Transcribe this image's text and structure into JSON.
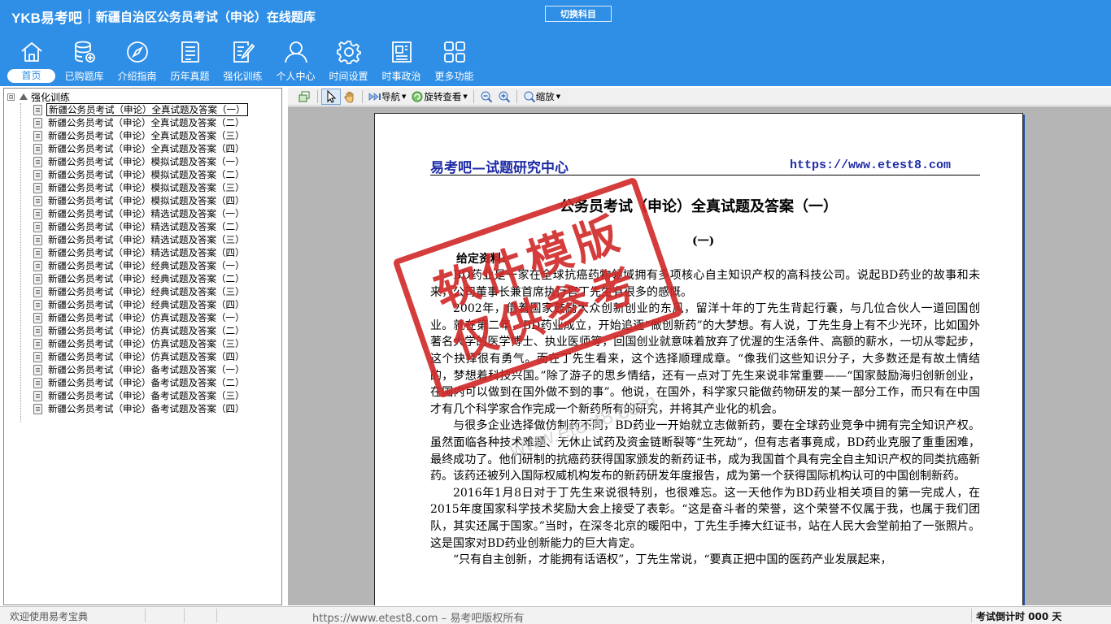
{
  "header": {
    "logo": "YKB易考吧",
    "app_title": "新疆自治区公务员考试（申论）在线题库",
    "switch_label": "切换科目"
  },
  "nav": [
    {
      "label": "首页",
      "icon": "home-icon"
    },
    {
      "label": "已购题库",
      "icon": "database-icon"
    },
    {
      "label": "介绍指南",
      "icon": "compass-icon"
    },
    {
      "label": "历年真题",
      "icon": "list-doc-icon"
    },
    {
      "label": "强化训练",
      "icon": "edit-doc-icon"
    },
    {
      "label": "个人中心",
      "icon": "user-icon"
    },
    {
      "label": "时间设置",
      "icon": "gear-icon"
    },
    {
      "label": "时事政治",
      "icon": "news-icon"
    },
    {
      "label": "更多功能",
      "icon": "grid-icon"
    }
  ],
  "tree": {
    "expander": "⊟",
    "root": "强化训练",
    "items": [
      "新疆公务员考试（申论）全真试题及答案（一）",
      "新疆公务员考试（申论）全真试题及答案（二）",
      "新疆公务员考试（申论）全真试题及答案（三）",
      "新疆公务员考试（申论）全真试题及答案（四）",
      "新疆公务员考试（申论）模拟试题及答案（一）",
      "新疆公务员考试（申论）模拟试题及答案（二）",
      "新疆公务员考试（申论）模拟试题及答案（三）",
      "新疆公务员考试（申论）模拟试题及答案（四）",
      "新疆公务员考试（申论）精选试题及答案（一）",
      "新疆公务员考试（申论）精选试题及答案（二）",
      "新疆公务员考试（申论）精选试题及答案（三）",
      "新疆公务员考试（申论）精选试题及答案（四）",
      "新疆公务员考试（申论）经典试题及答案（一）",
      "新疆公务员考试（申论）经典试题及答案（二）",
      "新疆公务员考试（申论）经典试题及答案（三）",
      "新疆公务员考试（申论）经典试题及答案（四）",
      "新疆公务员考试（申论）仿真试题及答案（一）",
      "新疆公务员考试（申论）仿真试题及答案（二）",
      "新疆公务员考试（申论）仿真试题及答案（三）",
      "新疆公务员考试（申论）仿真试题及答案（四）",
      "新疆公务员考试（申论）备考试题及答案（一）",
      "新疆公务员考试（申论）备考试题及答案（二）",
      "新疆公务员考试（申论）备考试题及答案（三）",
      "新疆公务员考试（申论）备考试题及答案（四）"
    ],
    "selected_index": 0
  },
  "toolbar": {
    "nav_label": "导航",
    "rotate_label": "旋转查看",
    "zoom_label": "缩放"
  },
  "document": {
    "header_left": "易考吧—试题研究中心",
    "header_right": "https://www.etest8.com",
    "title": "公务员考试（申论）全真试题及答案（一）",
    "section": "(一)",
    "material_label": "给定资料:",
    "paragraphs": [
      "BD药业是一家在全球抗癌药物领域拥有多项核心自主知识产权的高科技公司。说起BD药业的故事和未来，公司董事长兼首席执行官丁先生有很多的感慨。",
      "2002年，借着国家鼓励大众创新创业的东风，留洋十年的丁先生背起行囊，与几位合伙人一道回国创业。就在第二年，BD药业成立，开始追逐“做创新药”的大梦想。有人说，丁先生身上有不少光环，比如国外著名大学的医学博士、执业医师等，回国创业就意味着放弃了优渥的生活条件、高额的薪水，一切从零起步，这个抉择很有勇气。而在丁先生看来，这个选择顺理成章。“像我们这些知识分子，大多数还是有故土情结的，梦想着科技兴国。”除了游子的思乡情结，还有一点对丁先生来说非常重要——“国家鼓励海归创新创业，在国内可以做到在国外做不到的事”。他说，在国外，科学家只能做药物研发的某一部分工作，而只有在中国才有几个科学家合作完成一个新药所有的研究，并将其产业化的机会。",
      "与很多企业选择做仿制药不同，BD药业一开始就立志做新药，要在全球药业竞争中拥有完全知识产权。虽然面临各种技术难题、无休止试药及资金链断裂等“生死劫”，但有志者事竟成，BD药业克服了重重困难，最终成功了。他们研制的抗癌药获得国家颁发的新药证书，成为我国首个具有完全自主知识产权的同类抗癌新药。该药还被列入国际权威机构发布的新药研发年度报告，成为第一个获得国际机构认可的中国创制新药。",
      "2016年1月8日对于丁先生来说很特别，也很难忘。这一天他作为BD药业相关项目的第一完成人，在2015年度国家科学技术奖励大会上接受了表彰。“这是奋斗者的荣誉，这个荣誉不仅属于我，也属于我们团队，其实还属于国家。”当时，在深冬北京的暖阳中，丁先生手捧大红证书，站在人民大会堂前拍了一张照片。这是国家对BD药业创新能力的巨大肯定。",
      "“只有自主创新，才能拥有话语权”，丁先生常说，“要真正把中国的医药产业发展起来，"
    ],
    "stamp_line1": "软件模版",
    "stamp_line2": "仅供参考",
    "watermark": "www.etest8.com"
  },
  "status": {
    "welcome": "欢迎使用易考宝典",
    "copyright": "https://www.etest8.com – 易考吧版权所有",
    "countdown": "考试倒计时 000 天"
  },
  "colors": {
    "header_bg": "#2f8fe6",
    "doc_header": "#1f2ca6",
    "stamp": "#d12828"
  }
}
